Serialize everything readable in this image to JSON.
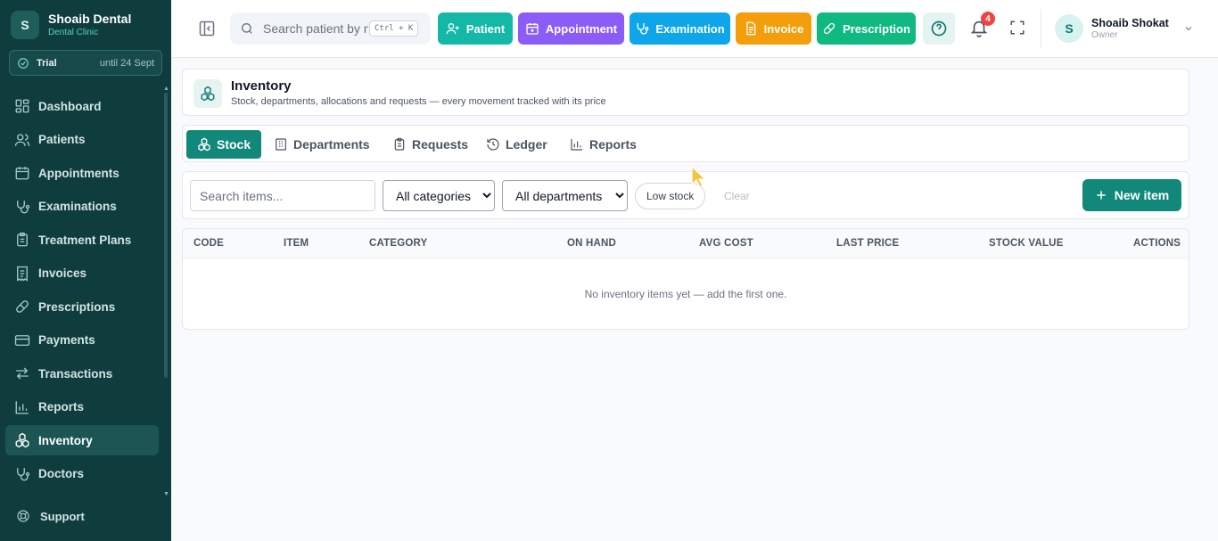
{
  "brand": {
    "initial": "S",
    "name": "Shoaib Dental",
    "subtitle": "Dental Clinic"
  },
  "trial": {
    "label": "Trial",
    "until": "until 24 Sept"
  },
  "sidebar": {
    "items": [
      {
        "label": "Dashboard",
        "icon": "dashboard-icon"
      },
      {
        "label": "Patients",
        "icon": "users-icon"
      },
      {
        "label": "Appointments",
        "icon": "calendar-icon"
      },
      {
        "label": "Examinations",
        "icon": "stethoscope-icon"
      },
      {
        "label": "Treatment Plans",
        "icon": "clipboard-icon"
      },
      {
        "label": "Invoices",
        "icon": "receipt-icon"
      },
      {
        "label": "Prescriptions",
        "icon": "pill-icon"
      },
      {
        "label": "Payments",
        "icon": "credit-card-icon"
      },
      {
        "label": "Transactions",
        "icon": "arrows-icon"
      },
      {
        "label": "Reports",
        "icon": "bar-chart-icon"
      },
      {
        "label": "Inventory",
        "icon": "boxes-icon",
        "active": true
      },
      {
        "label": "Doctors",
        "icon": "stethoscope-icon"
      }
    ],
    "support_label": "Support"
  },
  "topbar": {
    "search_placeholder": "Search patient by n",
    "shortcut": "Ctrl + K",
    "quick_buttons": [
      {
        "label": "Patient",
        "color": "#14b8a6",
        "icon": "user-plus-icon"
      },
      {
        "label": "Appointment",
        "color": "#8b5cf6",
        "icon": "calendar-plus-icon"
      },
      {
        "label": "Examination",
        "color": "#0ea5e9",
        "icon": "stethoscope-icon"
      },
      {
        "label": "Invoice",
        "color": "#f59e0b",
        "icon": "file-text-icon"
      },
      {
        "label": "Prescription",
        "color": "#10b981",
        "icon": "pill-icon"
      }
    ],
    "notifications_count": "4",
    "user": {
      "initial": "S",
      "name": "Shoaib Shokat",
      "role": "Owner"
    }
  },
  "page": {
    "title": "Inventory",
    "subtitle": "Stock, departments, allocations and requests — every movement tracked with its price"
  },
  "tabs": [
    {
      "label": "Stock",
      "icon": "boxes-icon",
      "active": true
    },
    {
      "label": "Departments",
      "icon": "building-icon"
    },
    {
      "label": "Requests",
      "icon": "clipboard-list-icon"
    },
    {
      "label": "Ledger",
      "icon": "history-icon"
    },
    {
      "label": "Reports",
      "icon": "bar-chart-icon"
    }
  ],
  "filters": {
    "search_placeholder": "Search items...",
    "category_selected": "All categories",
    "department_selected": "All departments",
    "low_stock_label": "Low stock",
    "clear_label": "Clear",
    "new_item_label": "New item"
  },
  "table": {
    "columns": [
      "CODE",
      "ITEM",
      "CATEGORY",
      "ON HAND",
      "AVG COST",
      "LAST PRICE",
      "STOCK VALUE",
      "ACTIONS"
    ],
    "empty_message": "No inventory items yet — add the first one."
  },
  "colors": {
    "sidebar_bg": "#0f3d3e",
    "accent": "#12887a",
    "badge": "#ef4444"
  }
}
